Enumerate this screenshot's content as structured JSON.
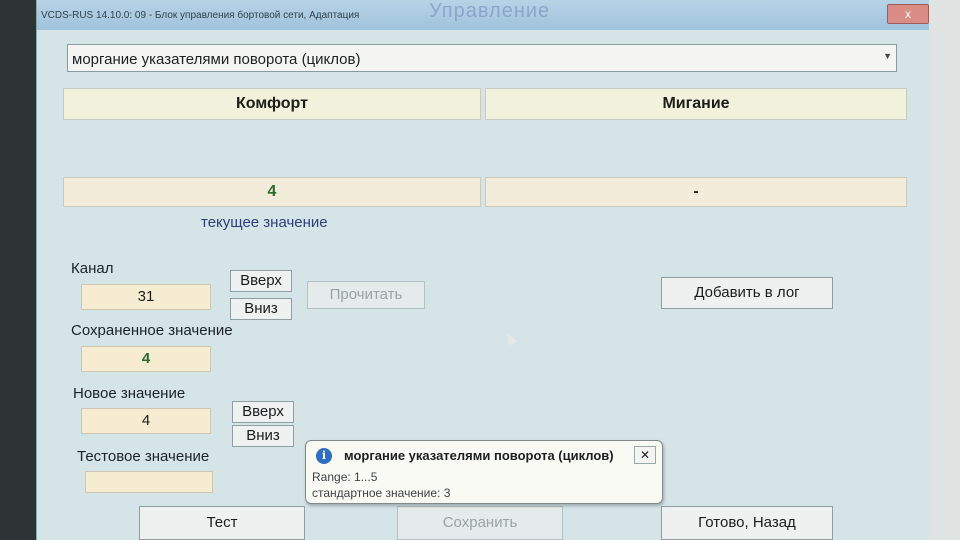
{
  "window": {
    "title": "VCDS-RUS 14.10.0: 09 - Блок управления бортовой сети, Адаптация",
    "watermark": "Управление",
    "close_label": "x"
  },
  "channel_dropdown": {
    "value": "моргание указателями поворота (циклов)",
    "arrow": "▼"
  },
  "headers": {
    "left": "Комфорт",
    "right": "Мигание"
  },
  "current": {
    "left_value": "4",
    "right_value": "-",
    "label": "текущее значение"
  },
  "channel": {
    "label": "Канал",
    "value": "31",
    "up_label": "Вверх",
    "down_label": "Вниз"
  },
  "read_button": "Прочитать",
  "add_log_button": "Добавить в лог",
  "saved": {
    "label": "Сохраненное значение",
    "value": "4"
  },
  "new_value": {
    "label": "Новое значение",
    "value": "4",
    "up_label": "Вверх",
    "down_label": "Вниз"
  },
  "test_value": {
    "label": "Тестовое значение",
    "value": ""
  },
  "tooltip": {
    "icon": "i",
    "title": "моргание указателями поворота (циклов)",
    "close_label": "✕",
    "range_line": "Range: 1...5",
    "default_line": "стандартное значение: 3"
  },
  "bottom_buttons": {
    "test": "Тест",
    "save": "Сохранить",
    "done": "Готово, Назад"
  }
}
